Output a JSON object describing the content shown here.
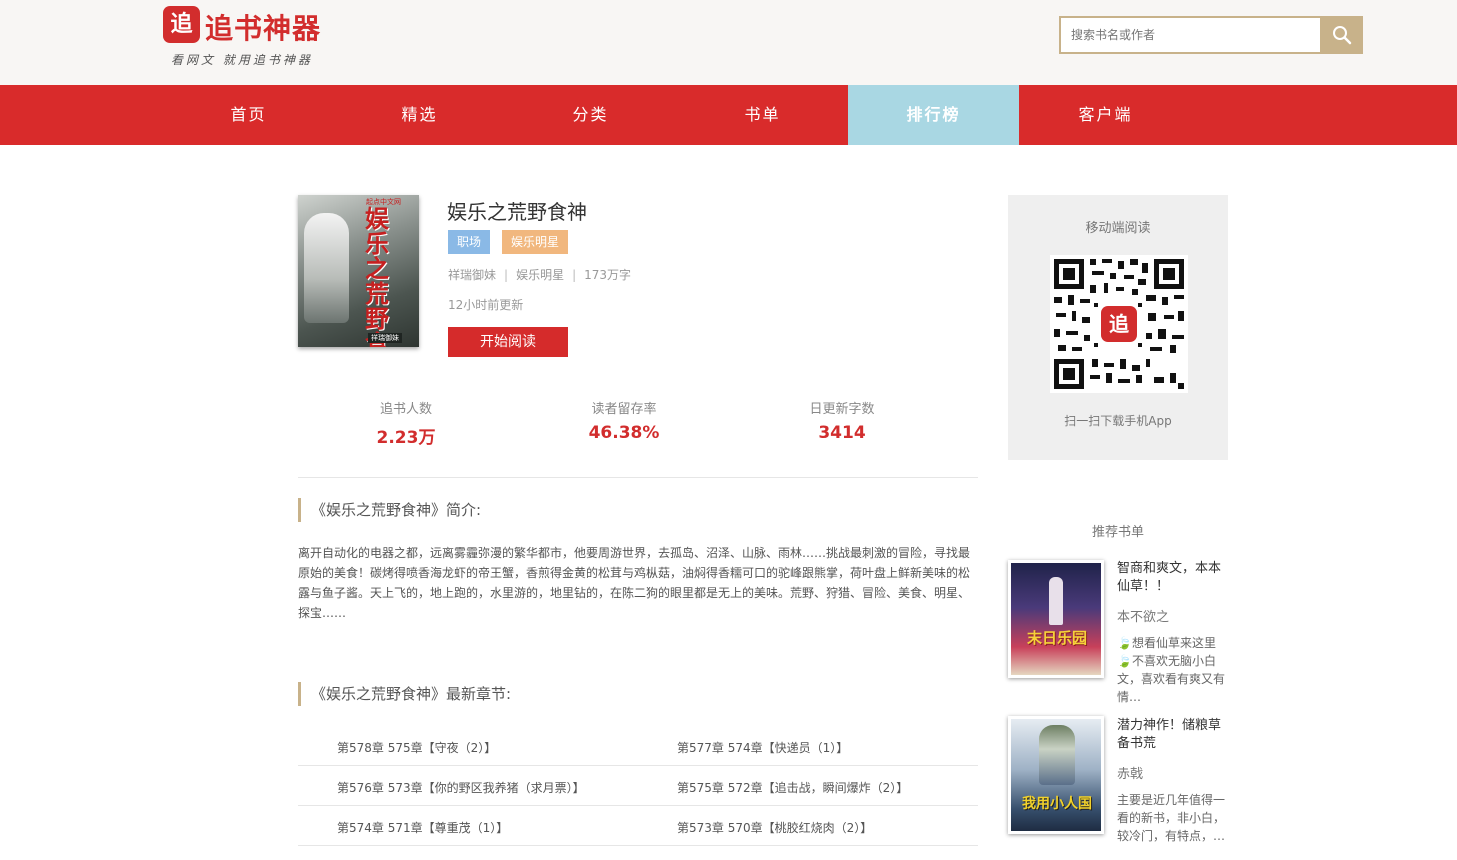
{
  "header": {
    "logo_mark": "追",
    "logo_text": "追书神器",
    "slogan": "看网文 就用追书神器",
    "search_placeholder": "搜索书名或作者"
  },
  "nav": [
    {
      "label": "首页"
    },
    {
      "label": "精选"
    },
    {
      "label": "分类"
    },
    {
      "label": "书单"
    },
    {
      "label": "排行榜",
      "active": true
    },
    {
      "label": "客户端"
    }
  ],
  "book": {
    "title": "娱乐之荒野食神",
    "cover_title": "娱乐之荒野食神",
    "cover_publisher": "起点中文网",
    "cover_author": "祥瑞御妹",
    "tags": [
      "职场",
      "娱乐明星"
    ],
    "author": "祥瑞御妹",
    "category": "娱乐明星",
    "word_count": "173万字",
    "updated": "12小时前更新",
    "read_button": "开始阅读"
  },
  "stats": [
    {
      "label": "追书人数",
      "value": "2.23万"
    },
    {
      "label": "读者留存率",
      "value": "46.38%"
    },
    {
      "label": "日更新字数",
      "value": "3414"
    }
  ],
  "intro": {
    "heading": "《娱乐之荒野食神》简介:",
    "text": "离开自动化的电器之都，远离雾霾弥漫的繁华都市，他要周游世界，去孤岛、沼泽、山脉、雨林……挑战最刺激的冒险，寻找最原始的美食！碳烤得喷香海龙虾的帝王蟹，香煎得金黄的松茸与鸡枞菇，油焖得香糯可口的驼峰跟熊掌，荷叶盘上鲜新美味的松露与鱼子酱。天上飞的，地上跑的，水里游的，地里钻的，在陈二狗的眼里都是无上的美味。荒野、狩猎、冒险、美食、明星、探宝……"
  },
  "chapters": {
    "heading": "《娱乐之荒野食神》最新章节:",
    "items": [
      "第578章 575章【守夜（2）】",
      "第577章 574章【快递员（1）】",
      "第576章 573章【你的野区我养猪（求月票）】",
      "第575章 572章【追击战，瞬间爆炸（2）】",
      "第574章 571章【尊重茂（1）】",
      "第573章 570章【桃胶红烧肉（2）】"
    ]
  },
  "sidebar": {
    "qr_title": "移动端阅读",
    "qr_caption": "扫一扫下载手机App",
    "qr_center": "追",
    "rec_title": "推荐书单",
    "recommendations": [
      {
        "name": "智商和爽文，本本仙草！！",
        "author": "本不欲之",
        "desc": "🍃想看仙草来这里🍃不喜欢无脑小白文，喜欢看有爽又有情…",
        "cover_text": "末日乐园",
        "cover_colors": [
          "#2a2550",
          "#d94040"
        ]
      },
      {
        "name": "潜力神作！储粮草备书荒",
        "author": "赤戟",
        "desc": "主要是近几年值得一看的新书，非小白，较冷门，有特点，…",
        "cover_text": "我用小人国",
        "cover_colors": [
          "#cfd8e6",
          "#f2d22b"
        ]
      }
    ]
  }
}
